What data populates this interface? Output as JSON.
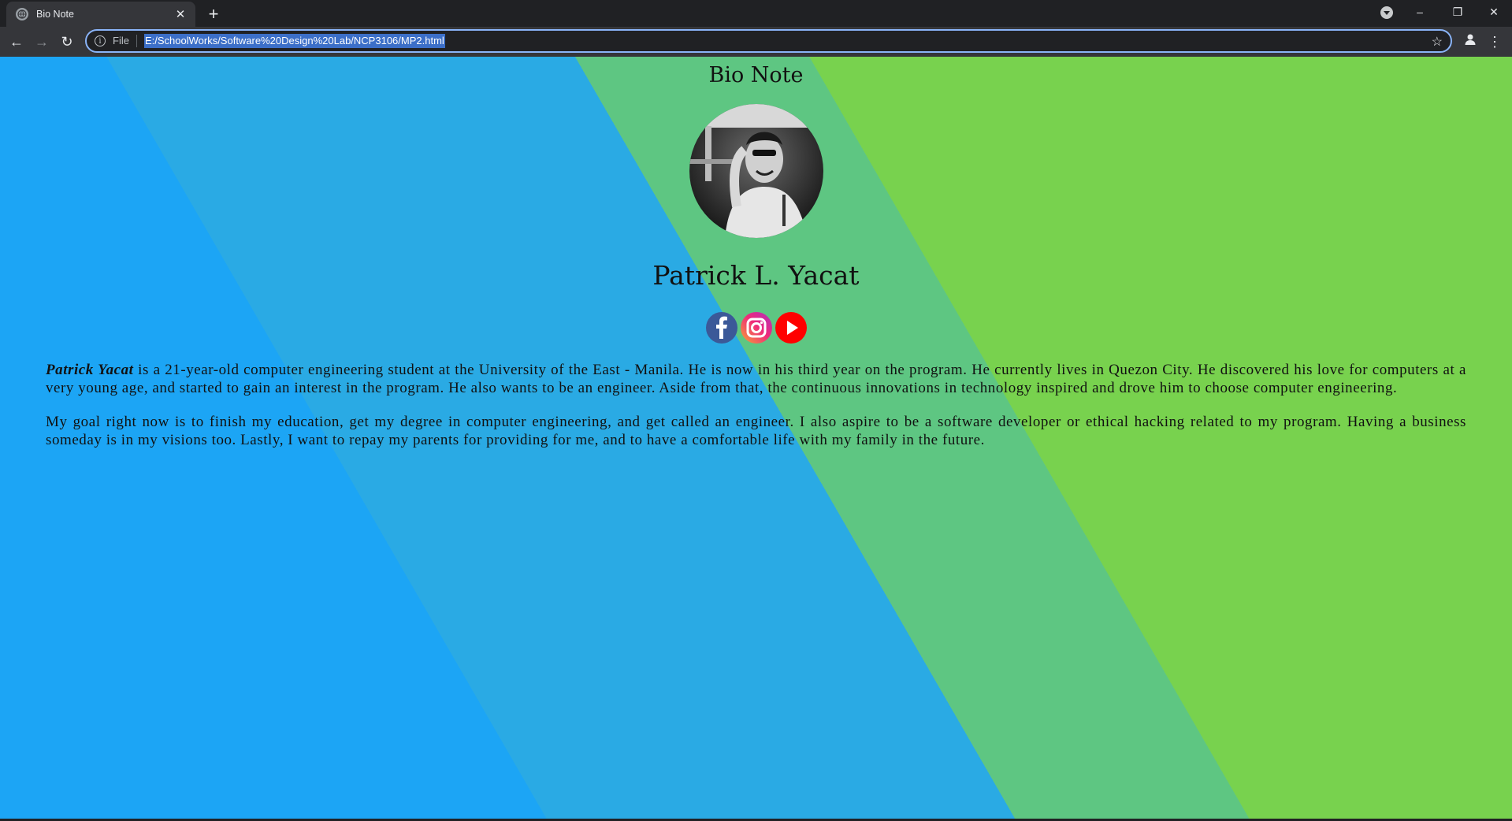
{
  "browser": {
    "tab_title": "Bio Note",
    "tab_close": "✕",
    "new_tab": "+",
    "scheme_label": "File",
    "url": "E:/SchoolWorks/Software%20Design%20Lab/NCP3106/MP2.html",
    "window_controls": [
      "–",
      "❐",
      "✕"
    ]
  },
  "page": {
    "heading": "Bio Note",
    "name": "Patrick L. Yacat",
    "socials": [
      {
        "name": "facebook",
        "glyph": "f"
      },
      {
        "name": "instagram",
        "glyph": ""
      },
      {
        "name": "youtube",
        "glyph": ""
      }
    ],
    "bio": {
      "p1_name": "Patrick Yacat",
      "p1_rest": " is a 21-year-old computer engineering student at the University of the East - Manila. He is now in his third year on the program. He currently lives in Quezon City. He discovered his love for computers at a very young age, and started to gain an interest in the program. He also wants to be an engineer. Aside from that, the continuous innovations in technology inspired and drove him to choose computer engineering.",
      "p2": "My goal right now is to finish my education, get my degree in computer engineering, and get called an engineer. I also aspire to be a software developer or ethical hacking related to my program. Having a business someday is in my visions too. Lastly, I want to repay my parents for providing for me, and to have a comfortable life with my family in the future."
    }
  },
  "colors": {
    "bg_band_1": "#1ca5f5",
    "bg_band_2": "#2aaae4",
    "bg_band_3": "#5ec682",
    "bg_band_4": "#78d24e",
    "facebook": "#3b5998",
    "youtube": "#ff0000"
  }
}
